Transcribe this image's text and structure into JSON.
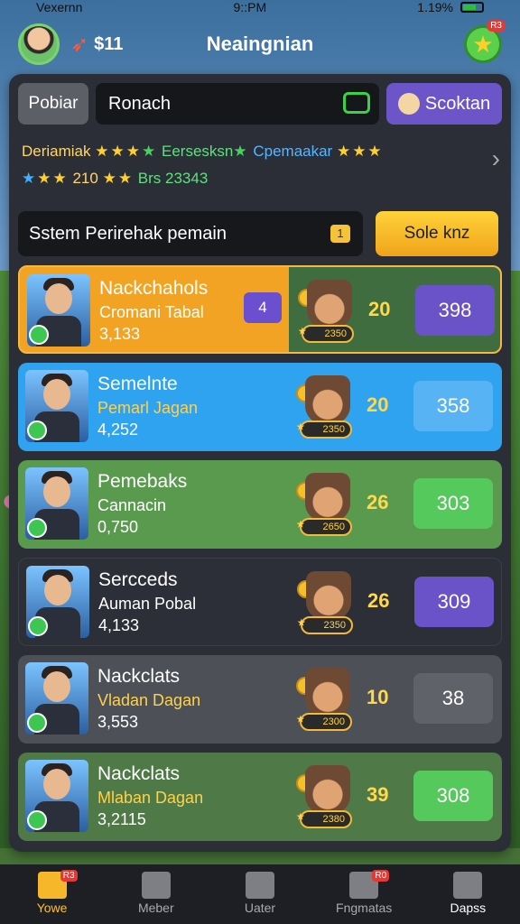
{
  "status": {
    "carrier": "Vexernn",
    "time": "9::PM",
    "battery": "1.19%"
  },
  "header": {
    "coins": "$11",
    "title": "Neaingnian",
    "notif": "R3"
  },
  "search": {
    "tab_label": "Pobiar",
    "value": "Ronach",
    "button": "Scoktan"
  },
  "ratings": {
    "line1_a": "Deriamiak",
    "line1_b": "Eersesksn",
    "line1_c": "Cpemaakar",
    "line2_a": "210",
    "line2_b": "Brs 23343"
  },
  "system": {
    "label": "Sstem Perirehak pemain",
    "badge": "1",
    "button": "Sole knz"
  },
  "rows": [
    {
      "name": "Nackchahols",
      "sub": "Cromani Tabal",
      "score": "3,133",
      "tag": "4",
      "chip": "2350",
      "level": "20",
      "value": "398"
    },
    {
      "name": "Semelnte",
      "sub": "Pemarl Jagan",
      "score": "4,252",
      "chip": "2350",
      "level": "20",
      "value": "358"
    },
    {
      "name": "Pemebaks",
      "sub": "Cannacin",
      "score": "0,750",
      "chip": "2650",
      "level": "26",
      "value": "303"
    },
    {
      "name": "Sercceds",
      "sub": "Auman Pobal",
      "score": "4,133",
      "chip": "2350",
      "level": "26",
      "value": "309"
    },
    {
      "name": "Nackclats",
      "sub": "Vladan Dagan",
      "score": "3,553",
      "chip": "2300",
      "level": "10",
      "value": "38"
    },
    {
      "name": "Nackclats",
      "sub": "Mlaban Dagan",
      "score": "3,2115",
      "chip": "2380",
      "level": "39",
      "value": "308"
    }
  ],
  "nav": {
    "items": [
      {
        "label": "Yowe",
        "badge": "R3"
      },
      {
        "label": "Meber"
      },
      {
        "label": "Uater"
      },
      {
        "label": "Fngmatas",
        "badge": "R0"
      },
      {
        "label": "Dapss"
      }
    ]
  }
}
